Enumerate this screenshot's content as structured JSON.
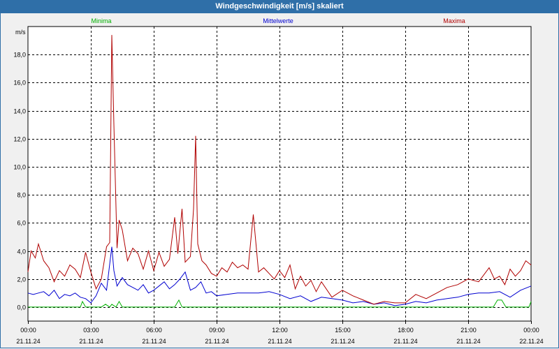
{
  "window": {
    "title": "Windgeschwindigkeit [m/s] skaliert"
  },
  "chart_data": {
    "type": "line",
    "title": "Windgeschwindigkeit [m/s] skaliert",
    "ylabel": "m/s",
    "ylim": [
      -1,
      20
    ],
    "yticks": [
      "0,0",
      "2,0",
      "4,0",
      "6,0",
      "8,0",
      "10,0",
      "12,0",
      "14,0",
      "16,0",
      "18,0"
    ],
    "xlim": [
      0,
      24
    ],
    "xticks": [
      {
        "time": "00:00",
        "date": "21.11.24"
      },
      {
        "time": "03:00",
        "date": "21.11.24"
      },
      {
        "time": "06:00",
        "date": "21.11.24"
      },
      {
        "time": "09:00",
        "date": "21.11.24"
      },
      {
        "time": "12:00",
        "date": "21.11.24"
      },
      {
        "time": "15:00",
        "date": "21.11.24"
      },
      {
        "time": "18:00",
        "date": "21.11.24"
      },
      {
        "time": "21:00",
        "date": "21.11.24"
      },
      {
        "time": "00:00",
        "date": "22.11.24"
      }
    ],
    "grid": true,
    "legend_position": "top",
    "series": [
      {
        "name": "Minima",
        "color": "#00b000",
        "x": [
          0,
          2.5,
          2.6,
          2.75,
          3.0,
          3.5,
          3.7,
          3.9,
          4.0,
          4.2,
          4.35,
          4.5,
          4.65,
          7.0,
          7.2,
          7.35,
          22.2,
          22.4,
          22.6,
          22.8,
          23.9,
          24
        ],
        "y": [
          0,
          0,
          0.4,
          0,
          0,
          0,
          0.2,
          0,
          0.2,
          0,
          0.4,
          0,
          0,
          0,
          0.5,
          0,
          0,
          0.5,
          0.5,
          0,
          0,
          0.4
        ]
      },
      {
        "name": "Mittelwerte",
        "color": "#0000d0",
        "x": [
          0,
          0.25,
          0.5,
          0.75,
          1.0,
          1.25,
          1.5,
          1.75,
          2.0,
          2.25,
          2.5,
          2.75,
          3.0,
          3.25,
          3.5,
          3.75,
          4.0,
          4.1,
          4.25,
          4.5,
          4.75,
          5.0,
          5.25,
          5.5,
          5.75,
          6.0,
          6.25,
          6.5,
          6.75,
          7.0,
          7.25,
          7.5,
          7.75,
          8.0,
          8.25,
          8.5,
          8.75,
          9.0,
          9.5,
          10.0,
          10.5,
          11.0,
          11.5,
          12.0,
          12.5,
          13.0,
          13.5,
          14.0,
          14.5,
          15.0,
          15.5,
          16.0,
          16.5,
          17.0,
          17.5,
          18.0,
          18.5,
          19.0,
          19.5,
          20.0,
          20.5,
          21.0,
          21.5,
          22.0,
          22.5,
          23.0,
          23.5,
          24.0
        ],
        "y": [
          1.0,
          0.9,
          1.0,
          1.1,
          0.8,
          1.2,
          0.6,
          0.9,
          0.8,
          1.0,
          0.7,
          0.6,
          0.3,
          0.8,
          1.7,
          1.2,
          4.3,
          2.6,
          1.5,
          2.1,
          1.6,
          1.4,
          1.2,
          1.6,
          1.0,
          1.2,
          1.5,
          1.8,
          1.3,
          1.6,
          2.0,
          2.5,
          1.2,
          1.4,
          1.8,
          1.0,
          1.1,
          0.8,
          0.9,
          1.0,
          1.0,
          1.0,
          1.1,
          0.9,
          0.6,
          0.8,
          0.4,
          0.7,
          0.6,
          0.5,
          0.3,
          0.4,
          0.2,
          0.3,
          0.1,
          0.2,
          0.4,
          0.3,
          0.5,
          0.6,
          0.7,
          0.9,
          1.0,
          1.0,
          1.1,
          0.7,
          1.2,
          1.5
        ]
      },
      {
        "name": "Maxima",
        "color": "#b00000",
        "x": [
          0,
          0.15,
          0.35,
          0.5,
          0.75,
          1.0,
          1.25,
          1.5,
          1.75,
          2.0,
          2.25,
          2.5,
          2.75,
          3.0,
          3.25,
          3.5,
          3.75,
          3.9,
          4.0,
          4.1,
          4.25,
          4.35,
          4.5,
          4.75,
          5.0,
          5.25,
          5.5,
          5.75,
          6.0,
          6.25,
          6.5,
          6.75,
          7.0,
          7.15,
          7.35,
          7.5,
          7.75,
          7.9,
          8.0,
          8.1,
          8.3,
          8.5,
          8.75,
          9.0,
          9.25,
          9.5,
          9.75,
          10.0,
          10.25,
          10.5,
          10.75,
          11.0,
          11.25,
          11.5,
          11.75,
          12.0,
          12.25,
          12.5,
          12.75,
          13.0,
          13.25,
          13.5,
          13.75,
          14.0,
          14.5,
          15.0,
          15.5,
          16.0,
          16.5,
          17.0,
          17.5,
          18.0,
          18.5,
          19.0,
          19.5,
          20.0,
          20.5,
          21.0,
          21.5,
          22.0,
          22.25,
          22.5,
          22.75,
          23.0,
          23.25,
          23.5,
          23.75,
          24.0
        ],
        "y": [
          2.5,
          4.0,
          3.5,
          4.5,
          3.3,
          2.8,
          1.8,
          2.6,
          2.2,
          3.0,
          2.7,
          2.1,
          3.9,
          2.5,
          1.3,
          2.0,
          4.3,
          4.6,
          19.4,
          13.0,
          4.2,
          6.2,
          5.5,
          3.3,
          4.2,
          3.8,
          2.7,
          4.0,
          2.6,
          3.9,
          2.9,
          3.4,
          6.4,
          3.8,
          7.0,
          3.2,
          3.6,
          7.0,
          12.2,
          4.5,
          3.3,
          3.0,
          2.4,
          2.2,
          2.8,
          2.5,
          3.2,
          2.8,
          3.0,
          2.7,
          6.6,
          2.5,
          2.8,
          2.4,
          2.0,
          2.6,
          2.1,
          3.0,
          1.3,
          2.2,
          1.5,
          1.9,
          1.1,
          1.8,
          0.7,
          1.2,
          0.8,
          0.5,
          0.2,
          0.4,
          0.3,
          0.3,
          0.9,
          0.6,
          1.0,
          1.4,
          1.6,
          2.0,
          1.8,
          2.8,
          2.0,
          2.2,
          1.6,
          2.7,
          2.2,
          2.6,
          3.3,
          3.0
        ]
      }
    ]
  }
}
